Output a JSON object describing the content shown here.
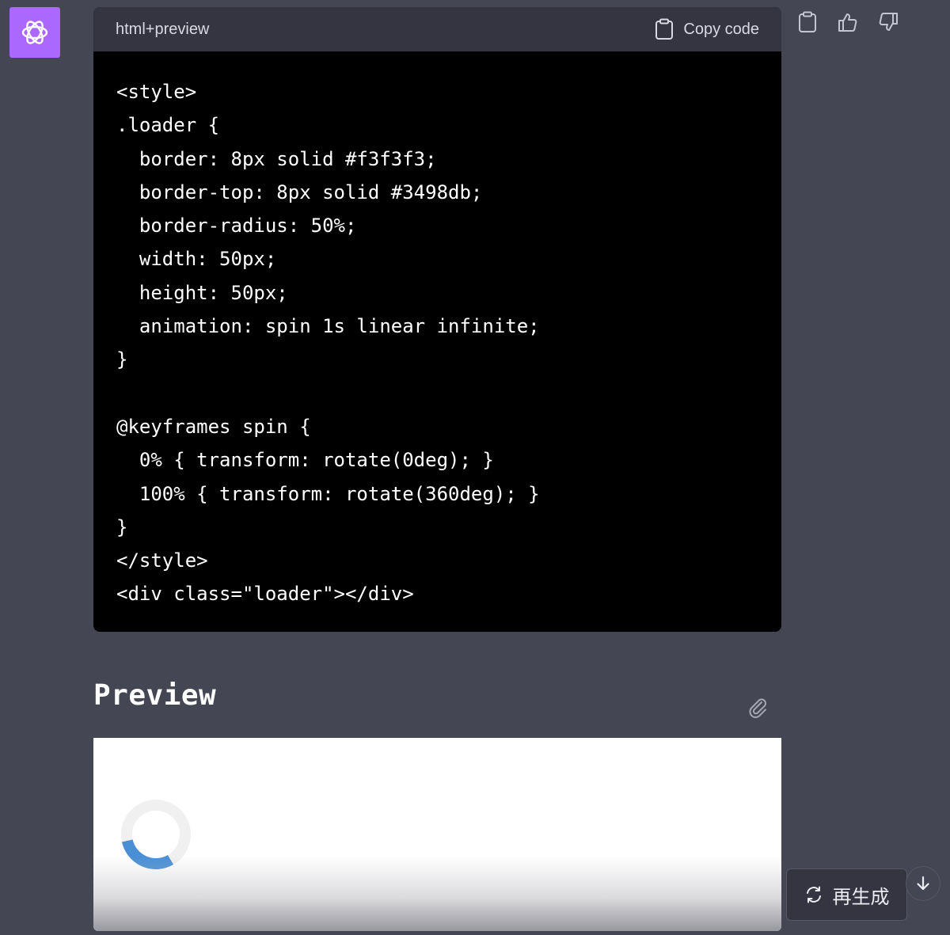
{
  "avatar": {
    "icon": "openai-logo-icon",
    "bg_color": "#ab68ff"
  },
  "code_block": {
    "language": "html+preview",
    "copy_label": "Copy code",
    "lines": [
      "<style>",
      ".loader {",
      "  border: 8px solid #f3f3f3;",
      "  border-top: 8px solid #3498db;",
      "  border-radius: 50%;",
      "  width: 50px;",
      "  height: 50px;",
      "  animation: spin 1s linear infinite;",
      "}",
      "",
      "@keyframes spin {",
      "  0% { transform: rotate(0deg); }",
      "  100% { transform: rotate(360deg); }",
      "}",
      "</style>",
      "<div class=\"loader\"></div>"
    ]
  },
  "message_actions": [
    {
      "name": "copy-message-button",
      "icon": "clipboard-icon"
    },
    {
      "name": "thumbs-up-button",
      "icon": "thumbs-up-icon"
    },
    {
      "name": "thumbs-down-button",
      "icon": "thumbs-down-icon"
    }
  ],
  "preview": {
    "title": "Preview",
    "icon": "paperclip-icon"
  },
  "loader_colors": {
    "ring": "#f0f0f0",
    "accent": "#4a8fd6"
  },
  "regenerate": {
    "label": "再生成",
    "icon": "refresh-icon"
  },
  "scroll_down": {
    "icon": "arrow-down-icon"
  }
}
